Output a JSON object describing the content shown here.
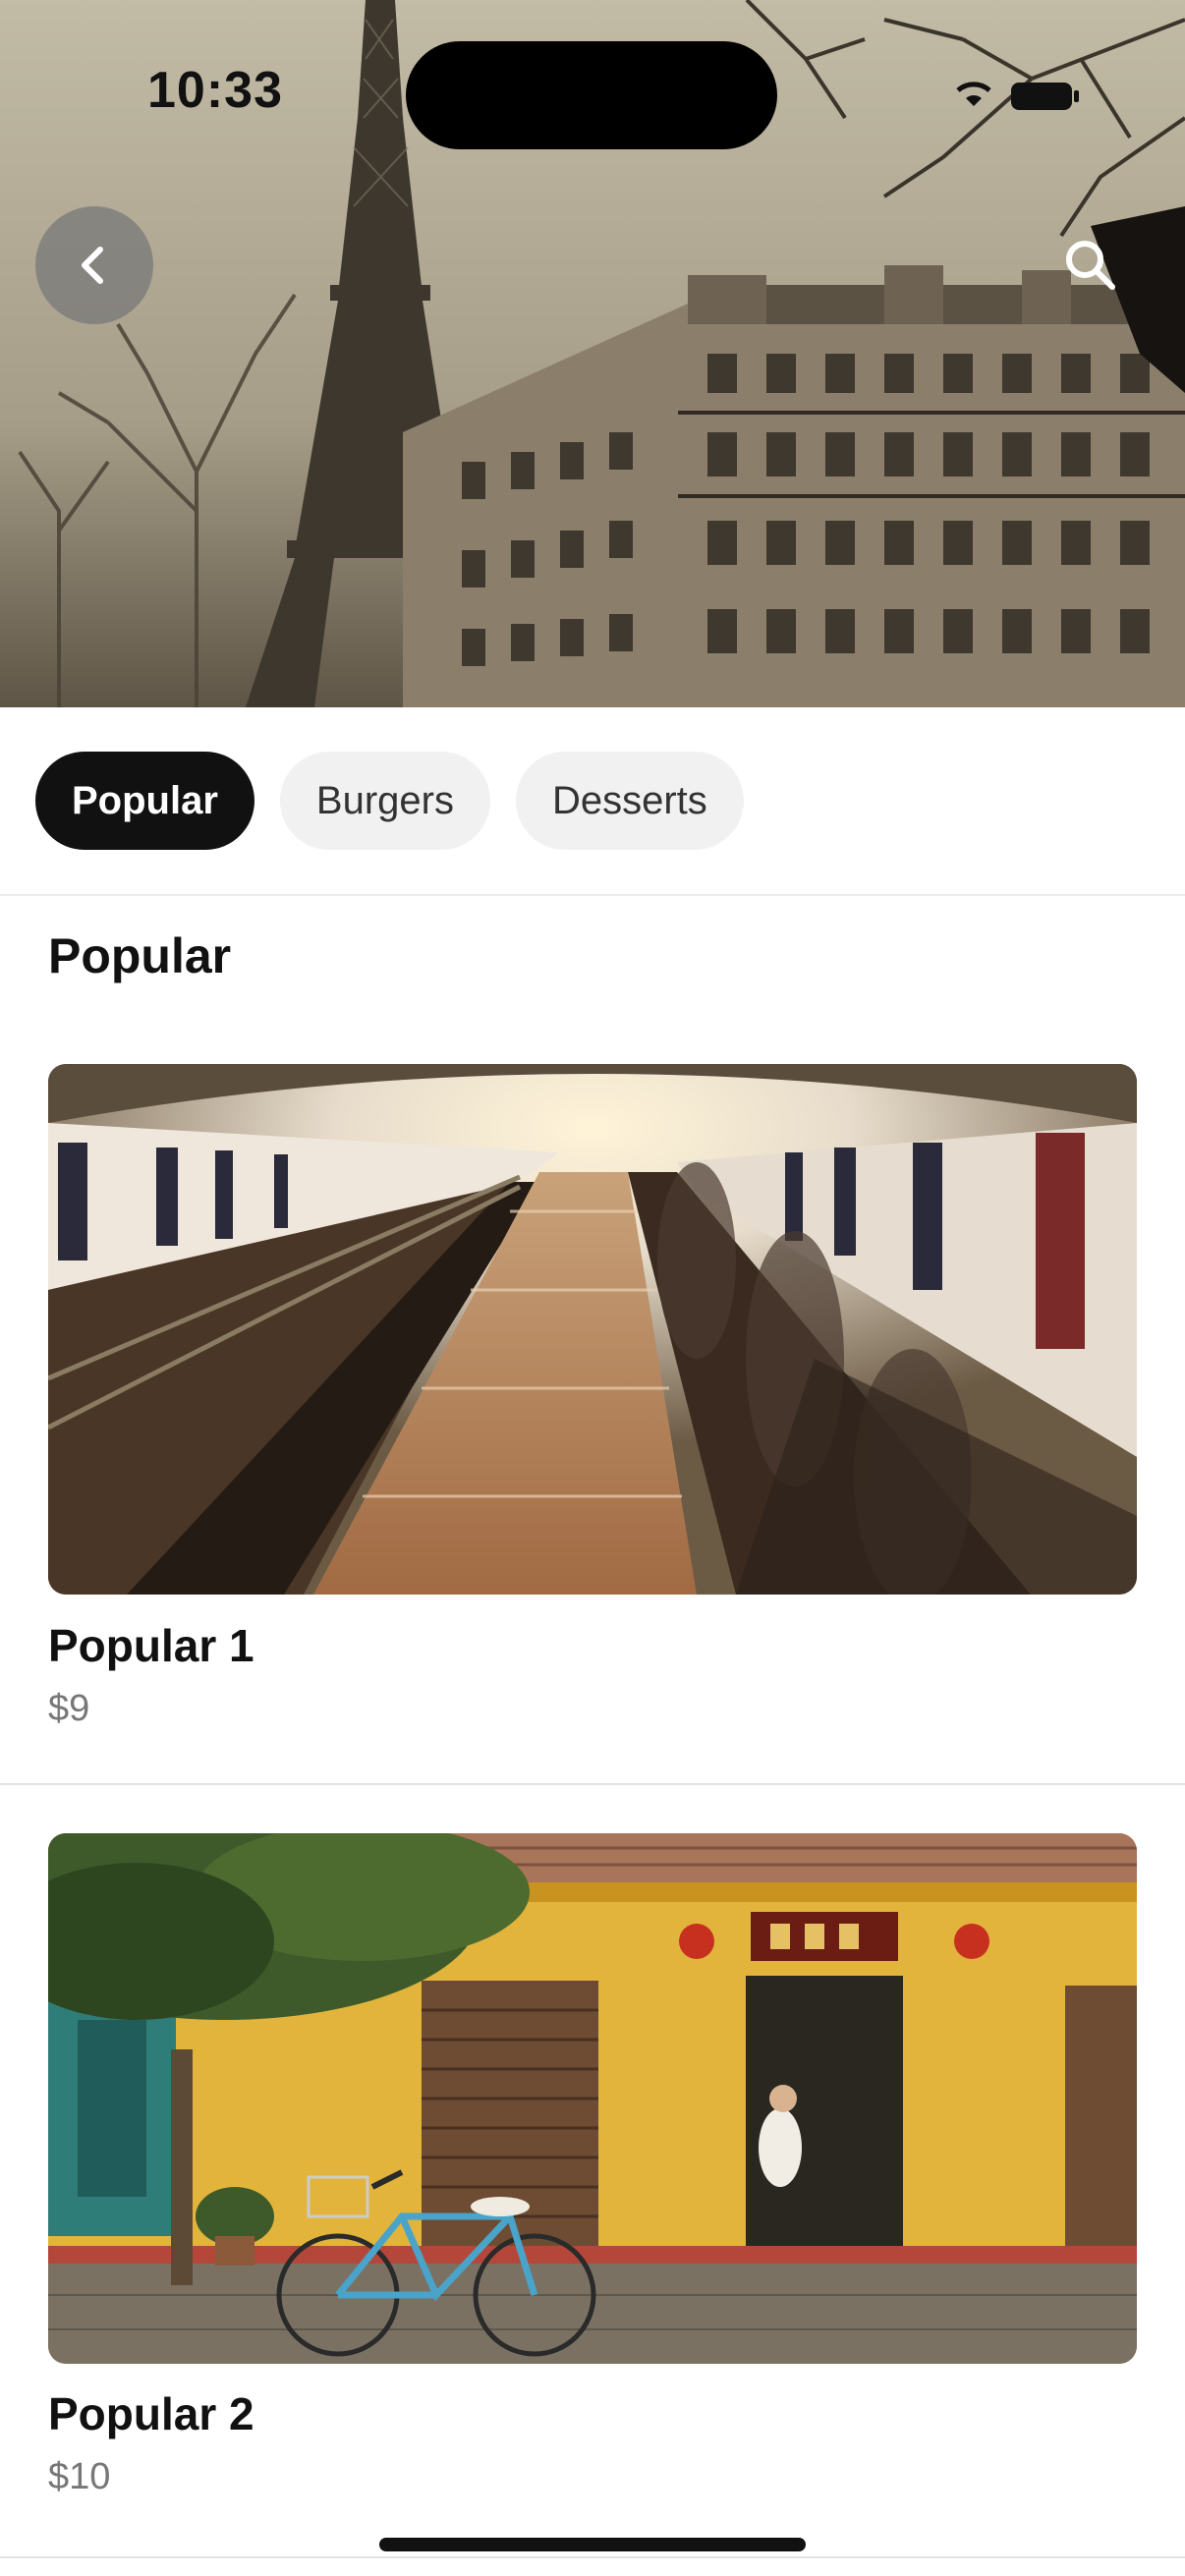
{
  "status_bar": {
    "time": "10:33"
  },
  "hero": {
    "back_icon": "chevron-left-icon",
    "search_icon": "search-icon"
  },
  "tabs": [
    {
      "label": "Popular",
      "active": true
    },
    {
      "label": "Burgers",
      "active": false
    },
    {
      "label": "Desserts",
      "active": false
    }
  ],
  "section": {
    "title": "Popular"
  },
  "items": [
    {
      "name": "Popular 1",
      "price": "$9"
    },
    {
      "name": "Popular 2",
      "price": "$10"
    }
  ]
}
